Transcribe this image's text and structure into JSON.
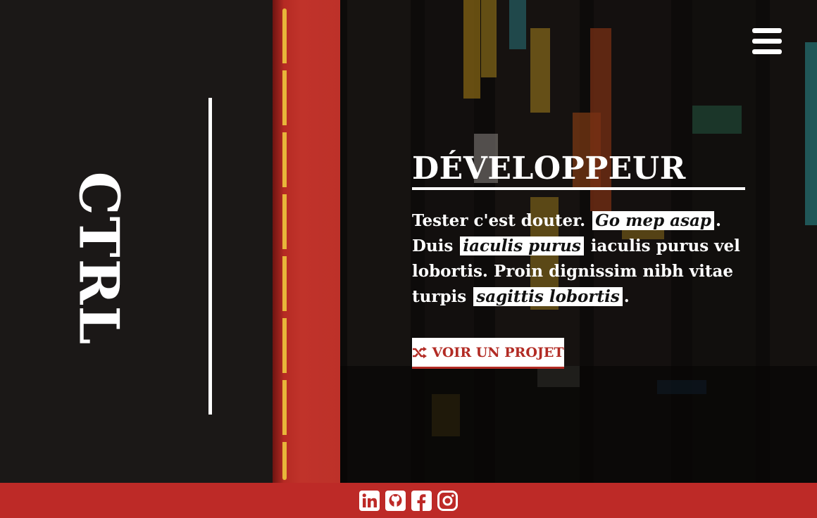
{
  "brand": {
    "logo_text": "CTRL"
  },
  "hero": {
    "title": "DÉVELOPPEUR",
    "description": {
      "p1": "Tester c'est douter. ",
      "h1": "Go mep asap",
      "p2": ".",
      "p3": "Duis ",
      "h2": "iaculis purus",
      "p4": " iaculis purus vel lobortis. Proin dignissim nibh vitae turpis ",
      "h3": "sagittis lobortis",
      "p5": "."
    },
    "cta_label": "VOIR UN PROJET",
    "cta_icon": "shuffle-icon"
  },
  "nav": {
    "menu_icon": "hamburger-icon"
  },
  "footer": {
    "social": [
      "linkedin-icon",
      "github-icon",
      "facebook-icon",
      "instagram-icon"
    ]
  },
  "colors": {
    "accent_red": "#bd2a27",
    "dark_bg": "#1b1817",
    "dash_yellow": "#e8b53a",
    "white": "#ffffff"
  }
}
